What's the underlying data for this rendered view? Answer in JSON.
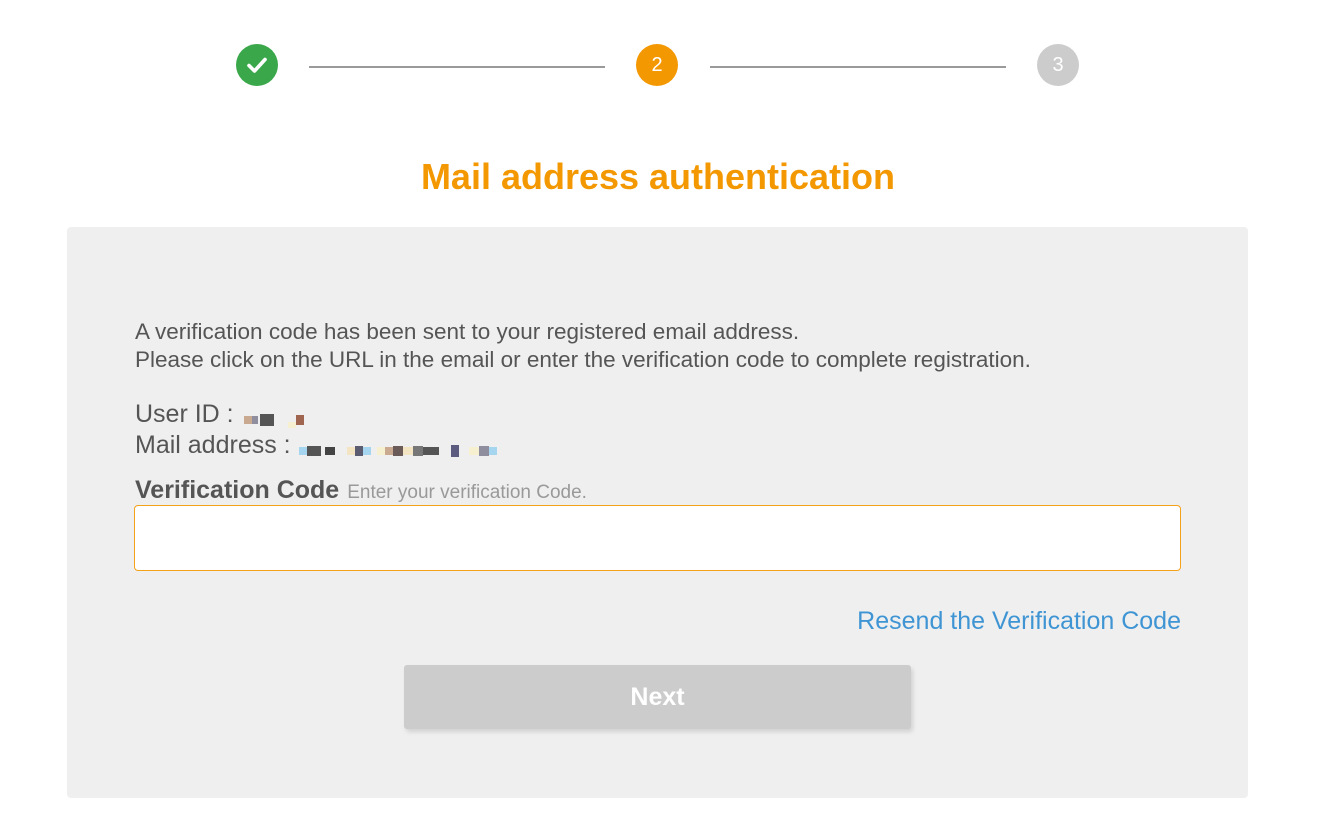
{
  "colors": {
    "accent": "#f39800",
    "complete": "#3aa84a",
    "pending": "#cccccc",
    "link": "#3f95d4",
    "input_border": "#f5a21b",
    "panel_bg": "#efefef"
  },
  "stepper": {
    "steps": [
      {
        "label": "",
        "status": "complete",
        "icon": "check-icon"
      },
      {
        "label": "2",
        "status": "current"
      },
      {
        "label": "3",
        "status": "pending"
      }
    ]
  },
  "page_title": "Mail address authentication",
  "intro": {
    "line1": "A verification code has been sent to your registered email address.",
    "line2": "Please click on the URL in the email or enter the verification code to complete registration."
  },
  "info": {
    "user_id_label": "User ID :",
    "mail_address_label": "Mail address :"
  },
  "verification": {
    "label": "Verification Code",
    "hint": "Enter your verification Code.",
    "value": "",
    "placeholder": ""
  },
  "resend_label": "Resend the Verification Code",
  "next_label": "Next"
}
